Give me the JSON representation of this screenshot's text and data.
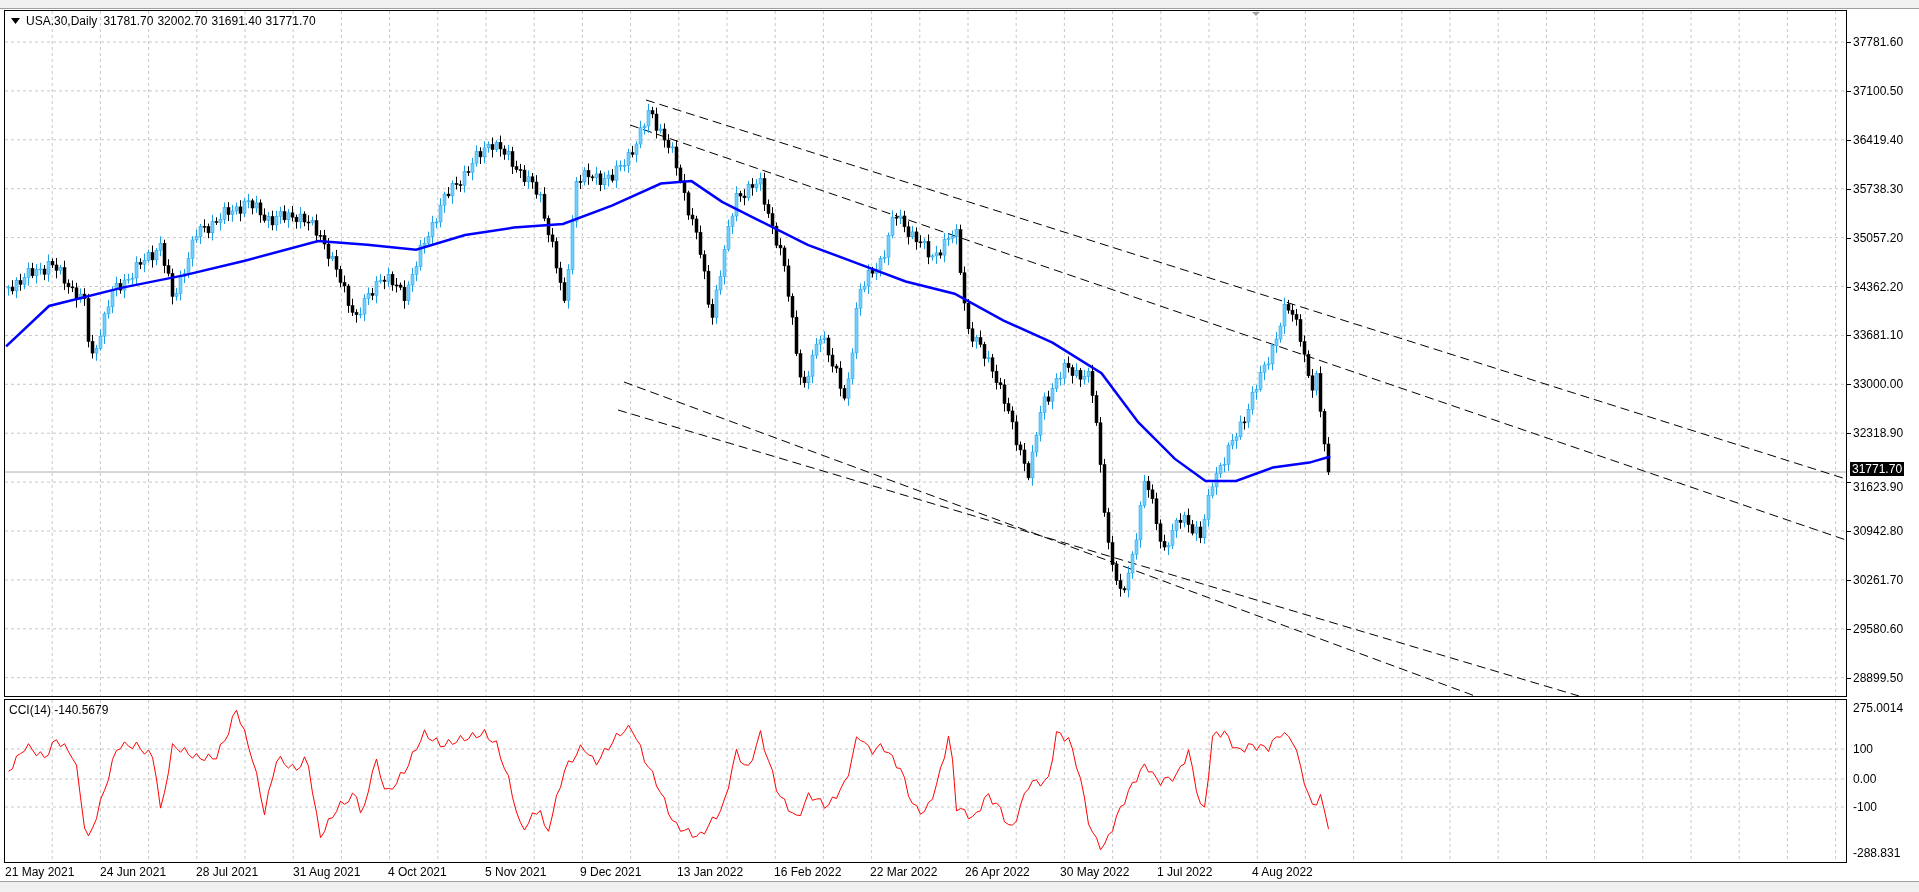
{
  "chart": {
    "symbol_caption": "USA.30,Daily",
    "ohlc": [
      "31781.70",
      "32002.70",
      "31691.40",
      "31771.70"
    ],
    "price_axis": [
      "37781.60",
      "37100.50",
      "36419.40",
      "35738.30",
      "35057.20",
      "34362.20",
      "33681.10",
      "33000.00",
      "32318.90",
      "31623.90",
      "30942.80",
      "30261.70",
      "29580.60",
      "28899.50"
    ],
    "current_price": "31771.70"
  },
  "indicator": {
    "caption": "CCI(14) -140.5679",
    "axis": [
      "275.0014",
      "100",
      "0.00",
      "-100",
      "-288.831"
    ]
  },
  "time_axis": [
    "21 May 2021",
    "24 Jun 2021",
    "28 Jul 2021",
    "31 Aug 2021",
    "4 Oct 2021",
    "5 Nov 2021",
    "9 Dec 2021",
    "13 Jan 2022",
    "16 Feb 2022",
    "22 Mar 2022",
    "26 Apr 2022",
    "30 May 2022",
    "1 Jul 2022",
    "4 Aug 2022"
  ]
}
